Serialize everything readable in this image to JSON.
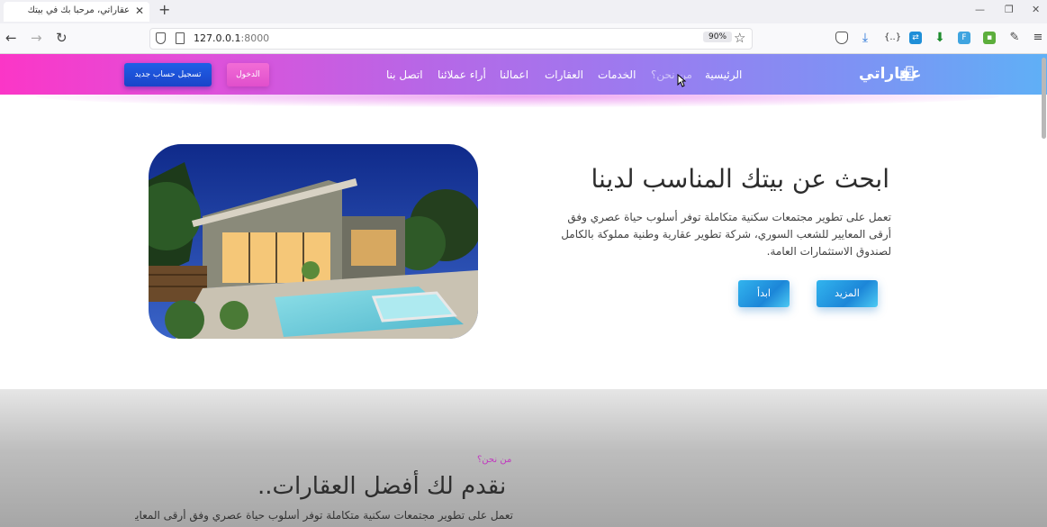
{
  "browser": {
    "tab_title": "عقاراتي، مرحبا بك في بيتك",
    "url_host": "127.0.0.1",
    "url_port": ":8000",
    "zoom": "90%"
  },
  "site": {
    "logo_text": "عقاراتي",
    "nav": {
      "home": "الرئيسية",
      "about": "من نحن؟",
      "services": "الخدمات",
      "properties": "العقارات",
      "works": "اعمالنا",
      "reviews": "أراء عملائنا",
      "contact": "اتصل بنا"
    },
    "login_label": "الدخول",
    "register_label": "تسجيل حساب جديد"
  },
  "hero": {
    "title": "ابحث عن بيتك المناسب لدينا",
    "text": "تعمل على تطوير مجتمعات سكنية متكاملة توفر أسلوب حياة عصري وفق أرقى المعايير للشعب السوري، شركة تطوير عقارية وطنية مملوكة بالكامل لصندوق الاستثمارات العامة.",
    "more_label": "المزيد",
    "start_label": "ابدأ"
  },
  "about": {
    "label": "من نحن؟",
    "title": "نقدم لك أفضل العقارات..",
    "text": "تعمل على تطوير مجتمعات سكنية متكاملة توفر أسلوب حياة عصري وفق أرقى المعايير للشعب"
  },
  "colors": {
    "header_start": "#fb36c7",
    "header_end": "#5fb0f6",
    "register_button": "#1f5fe6",
    "login_button": "#e04fcc",
    "hero_button": "#1c86d8",
    "about_label": "#c03abf"
  }
}
